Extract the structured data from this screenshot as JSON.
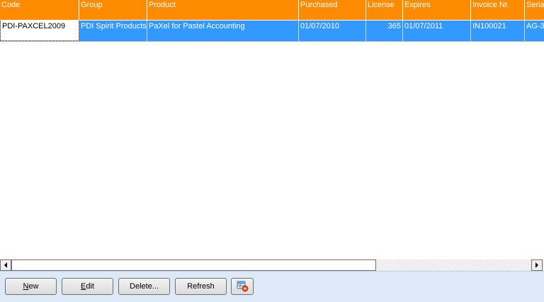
{
  "grid": {
    "columns": [
      {
        "key": "code",
        "label": "Code"
      },
      {
        "key": "group",
        "label": "Group"
      },
      {
        "key": "product",
        "label": "Product"
      },
      {
        "key": "purchased",
        "label": "Purchased"
      },
      {
        "key": "license",
        "label": "License"
      },
      {
        "key": "expires",
        "label": "Expires"
      },
      {
        "key": "invoice",
        "label": "Invoice Nr."
      },
      {
        "key": "serial",
        "label": "Seria"
      }
    ],
    "rows": [
      {
        "code": "PDI-PAXCEL2009",
        "group": "PDI Spirit Products",
        "product": "PaXel for Pastel Accounting",
        "purchased": "01/07/2010",
        "license": "365",
        "expires": "01/07/2011",
        "invoice": "IN100021",
        "serial": "AG-3"
      }
    ]
  },
  "toolbar": {
    "new": {
      "accel": "N",
      "rest": "ew"
    },
    "edit": {
      "accel": "E",
      "rest": "dit"
    },
    "delete_label": "Delete...",
    "refresh_label": "Refresh"
  },
  "icons": {
    "column-chooser": "grid-settings-icon"
  },
  "colors": {
    "header_bg": "#ff8c00",
    "header_text": "#ffffff",
    "selection_bg": "#3399ff",
    "toolbar_bg": "#dde9f6"
  }
}
